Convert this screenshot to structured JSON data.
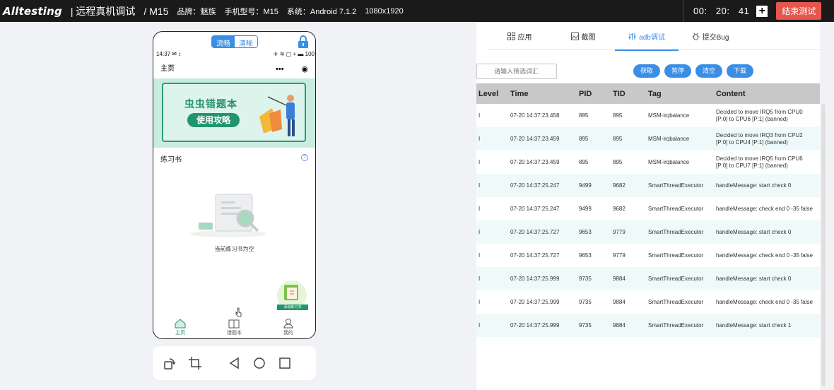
{
  "topbar": {
    "logo": "Alltesting",
    "title": "| 远程真机调试",
    "model": "/ M15",
    "brand": "品牌：魅族",
    "phone_model": "手机型号：M15",
    "system": "系统：Android 7.1.2",
    "resolution": "1080x1920",
    "timer_h": "00:",
    "timer_m": "20:",
    "timer_s": "41",
    "plus": "+",
    "end_label": "结束测试"
  },
  "phone": {
    "quality_options": [
      "流畅",
      "清晰"
    ],
    "status_time": "14:37",
    "status_battery": "100",
    "app_title": "主页",
    "banner_title": "虫虫错题本",
    "banner_button": "使用攻略",
    "section_title": "练习书",
    "empty_text": "当前练习书为空",
    "float_label": "添加练习书",
    "tabs": [
      {
        "label": "主页",
        "active": true
      },
      {
        "label": "错题本",
        "active": false
      },
      {
        "label": "我的",
        "active": false
      }
    ]
  },
  "panel": {
    "tabs": [
      {
        "label": "应用",
        "icon": "grid-icon"
      },
      {
        "label": "截图",
        "icon": "image-icon"
      },
      {
        "label": "adb调试",
        "icon": "adb-icon",
        "active": true
      },
      {
        "label": "提交Bug",
        "icon": "bug-icon"
      }
    ],
    "filter_placeholder": "请输入筛选词汇",
    "buttons": [
      "获取",
      "暂停",
      "清空",
      "下载"
    ],
    "columns": [
      "Level",
      "Time",
      "PID",
      "TID",
      "Tag",
      "Content"
    ],
    "rows": [
      [
        "I",
        "07-20 14:37:23.458",
        "895",
        "895",
        "MSM-irqbalance",
        "Decided to move IRQ5 from CPU0 [P:0] to CPU6 [P:1] (banned)"
      ],
      [
        "I",
        "07-20 14:37:23.459",
        "895",
        "895",
        "MSM-irqbalance",
        "Decided to move IRQ3 from CPU2 [P:0] to CPU4 [P:1] (banned)"
      ],
      [
        "I",
        "07-20 14:37:23.459",
        "895",
        "895",
        "MSM-irqbalance",
        "Decided to move IRQ5 from CPU6 [P:0] to CPU7 [P:1] (banned)"
      ],
      [
        "I",
        "07-20 14:37:25.247",
        "9499",
        "9682",
        "SmartThreadExecutor",
        "handleMessage: start check 0"
      ],
      [
        "I",
        "07-20 14:37:25.247",
        "9499",
        "9682",
        "SmartThreadExecutor",
        "handleMessage: check end 0 -35 false"
      ],
      [
        "I",
        "07-20 14:37:25.727",
        "9653",
        "9779",
        "SmartThreadExecutor",
        "handleMessage: start check 0"
      ],
      [
        "I",
        "07-20 14:37:25.727",
        "9653",
        "9779",
        "SmartThreadExecutor",
        "handleMessage: check end 0 -35 false"
      ],
      [
        "I",
        "07-20 14:37:25.999",
        "9735",
        "9884",
        "SmartThreadExecutor",
        "handleMessage: start check 0"
      ],
      [
        "I",
        "07-20 14:37:25.999",
        "9735",
        "9884",
        "SmartThreadExecutor",
        "handleMessage: check end 0 -35 false"
      ],
      [
        "I",
        "07-20 14:37:25.999",
        "9735",
        "9884",
        "SmartThreadExecutor",
        "handleMessage: start check 1"
      ]
    ]
  },
  "colors": {
    "accent": "#3a8ee6",
    "danger": "#e5564c",
    "green": "#23946c"
  }
}
